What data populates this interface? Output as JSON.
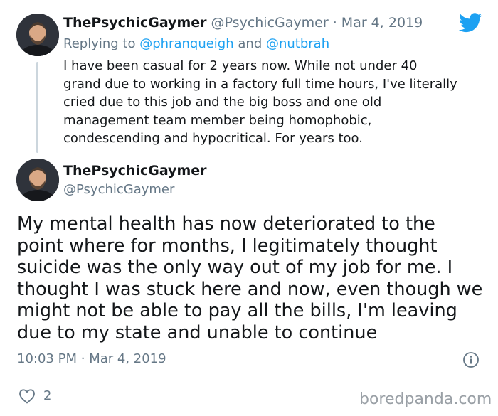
{
  "reply_tweet": {
    "display_name": "ThePsychicGaymer",
    "handle": "@PsychicGaymer",
    "separator": "·",
    "date": "Mar 4, 2019",
    "replying_prefix": "Replying to",
    "replying_to_1": "@phranqueigh",
    "replying_and": "and",
    "replying_to_2": "@nutbrah",
    "text_lines": [
      "I have been casual for 2 years now. While not under 40",
      "grand due to working in a factory full time hours, I've literally",
      "cried due to this job and the big boss and one old",
      "management team member being homophobic,",
      "condescending and hypocritical. For years too."
    ]
  },
  "main_tweet": {
    "display_name": "ThePsychicGaymer",
    "handle": "@PsychicGaymer",
    "text_lines": [
      "My mental health has now deteriorated to the",
      "point where for months, I legitimately thought",
      "suicide was the only way out of my job for me. I",
      "thought I was stuck here and now, even though we",
      "might not be able to pay all the bills, I'm leaving",
      "due to my state and unable to continue"
    ],
    "time": "10:03 PM",
    "separator": "·",
    "date": "Mar 4, 2019",
    "like_count": "2"
  },
  "watermark": "boredpanda.com",
  "icons": {
    "brand": "twitter-bird-icon",
    "info": "info-icon",
    "like": "heart-icon"
  },
  "colors": {
    "twitter_blue": "#1da1f2",
    "secondary_text": "#657786",
    "primary_text": "#14171a",
    "divider": "#e1e8ed",
    "thread_line": "#ccd6dd"
  }
}
